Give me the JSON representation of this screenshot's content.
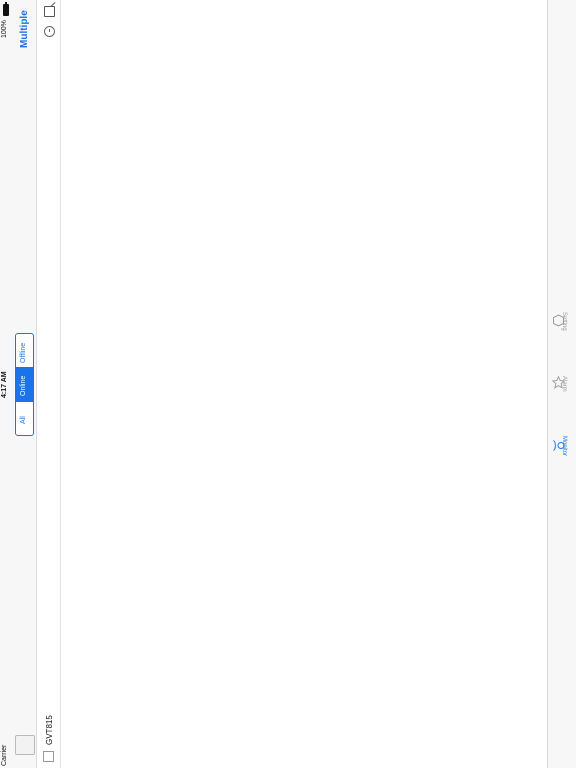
{
  "status_bar": {
    "carrier": "Carrier",
    "time": "4:17 AM",
    "battery": "100%"
  },
  "nav": {
    "title": "Multiple",
    "segments": [
      "Offline",
      "Online",
      "All"
    ],
    "selected_segment": "Online"
  },
  "device_list": {
    "items": [
      {
        "name": "GVT815",
        "checked": false
      }
    ]
  },
  "tab_bar": {
    "active_tab": "Monitor",
    "tabs": [
      {
        "label": "Setting",
        "icon": "settings-icon"
      },
      {
        "label": "Alarm",
        "icon": "star-icon"
      },
      {
        "label": "Monitor",
        "icon": "person-icon"
      }
    ]
  },
  "colors": {
    "accent": "#1a73e8",
    "bar_background": "#f7f7f7",
    "inactive": "#999999"
  }
}
